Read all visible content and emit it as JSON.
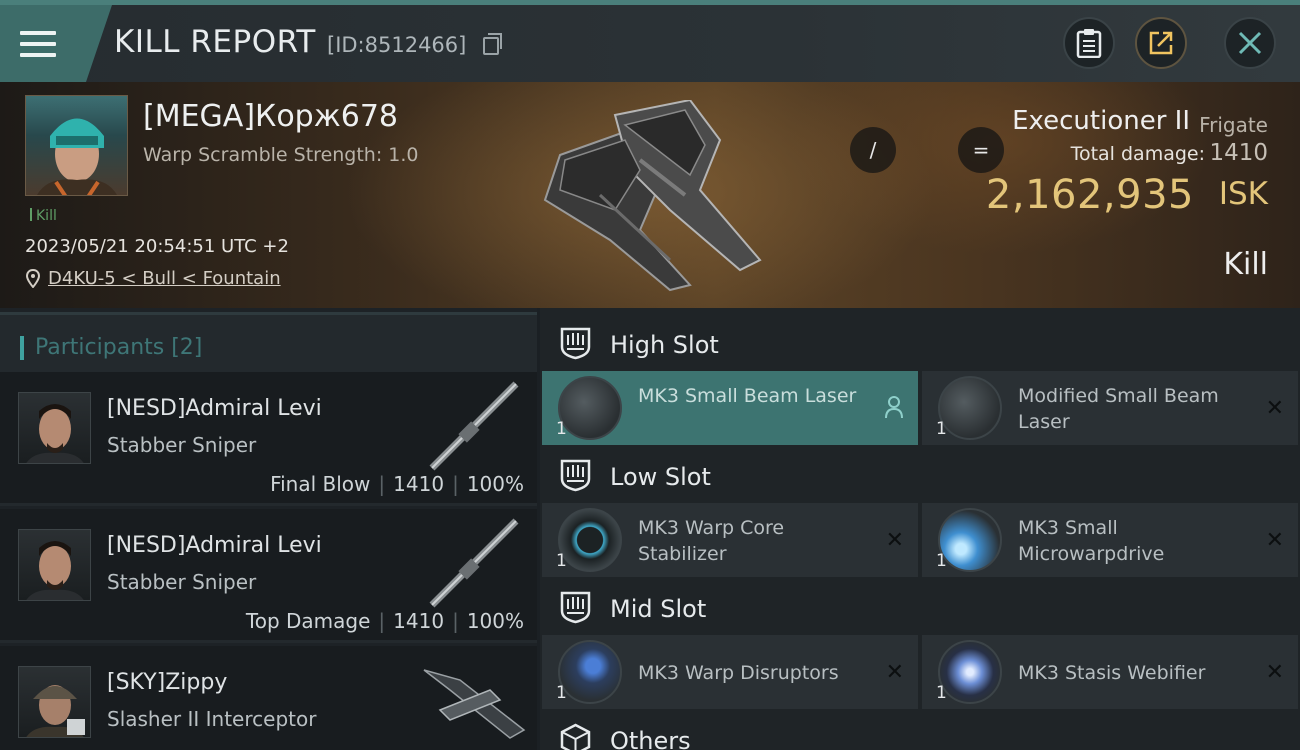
{
  "header": {
    "title": "KILL REPORT",
    "report_id": "[ID:8512466]"
  },
  "victim": {
    "name": "[MEGA]Корж678",
    "subtitle": "Warp Scramble Strength: 1.0",
    "kill_tag": "Kill",
    "timestamp": "2023/05/21 20:54:51 UTC +2",
    "location": "D4KU-5 < Bull < Fountain"
  },
  "summary": {
    "op_slash": "/",
    "op_equals": "=",
    "ship_name": "Executioner II",
    "ship_class": "Frigate",
    "total_damage_label": "Total damage:",
    "total_damage_value": "1410",
    "isk_value": "2,162,935",
    "isk_unit": "ISK",
    "outcome": "Kill"
  },
  "participants": {
    "title": "Participants [2]",
    "items": [
      {
        "name": "[NESD]Admiral Levi",
        "ship": "Stabber Sniper",
        "role": "Final Blow",
        "damage": "1410",
        "percent": "100%"
      },
      {
        "name": "[NESD]Admiral Levi",
        "ship": "Stabber Sniper",
        "role": "Top Damage",
        "damage": "1410",
        "percent": "100%"
      },
      {
        "name": "[SKY]Zippy",
        "ship": "Slasher II Interceptor"
      }
    ]
  },
  "slots": {
    "high": {
      "title": "High Slot",
      "items": [
        {
          "qty": "1",
          "name": "MK3 Small Beam Laser"
        },
        {
          "qty": "1",
          "name": "Modified Small Beam Laser"
        }
      ]
    },
    "low": {
      "title": "Low Slot",
      "items": [
        {
          "qty": "1",
          "name": "MK3 Warp Core Stabilizer"
        },
        {
          "qty": "1",
          "name": "MK3 Small Microwarpdrive"
        }
      ]
    },
    "mid": {
      "title": "Mid Slot",
      "items": [
        {
          "qty": "1",
          "name": "MK3 Warp Disruptors"
        },
        {
          "qty": "1",
          "name": "MK3 Stasis Webifier"
        }
      ]
    },
    "others": {
      "title": "Others"
    }
  },
  "icons": {
    "menu": "menu-icon",
    "copy": "copy-icon",
    "clipboard": "clipboard-icon",
    "share": "share-icon",
    "close": "close-icon",
    "location": "pin-icon",
    "slot": "shield-icon",
    "dropped": "person-icon",
    "destroyed": "x-mark-icon"
  },
  "colors": {
    "accent": "#3d6c69",
    "isk": "#e3c57a",
    "active_item": "#3d7471",
    "kill_tag": "#5f9f66"
  }
}
